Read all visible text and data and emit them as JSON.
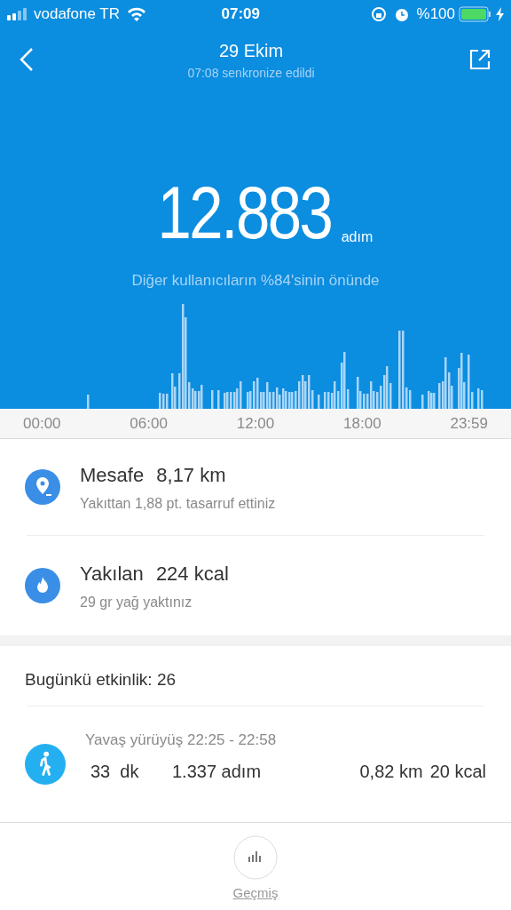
{
  "status_bar": {
    "carrier": "vodafone TR",
    "time": "07:09",
    "battery": "%100"
  },
  "header": {
    "title": "29 Ekim",
    "subtitle": "07:08 senkronize edildi"
  },
  "steps": {
    "value": "12.883",
    "unit": "adım",
    "note": "Diğer kullanıcıların %84'sinin önünde"
  },
  "axis_labels": [
    "00:00",
    "06:00",
    "12:00",
    "18:00",
    "23:59"
  ],
  "summary": [
    {
      "kind": "distance",
      "label": "Mesafe",
      "value": "8,17 km",
      "detail": "Yakıttan 1,88 pt. tasarruf ettiniz"
    },
    {
      "kind": "calories",
      "label": "Yakılan",
      "value": "224 kcal",
      "detail": "29 gr yağ yaktınız"
    }
  ],
  "activity_heading": "Bugünkü etkinlik: 26",
  "activities": [
    {
      "kind": "walk",
      "title": "Yavaş yürüyüş 22:25 - 22:58",
      "duration": "33  dk",
      "steps": "1.337 adım",
      "distance": "0,82 km",
      "calories": "20 kcal"
    }
  ],
  "bottom_tab": {
    "label": "Geçmiş"
  }
}
